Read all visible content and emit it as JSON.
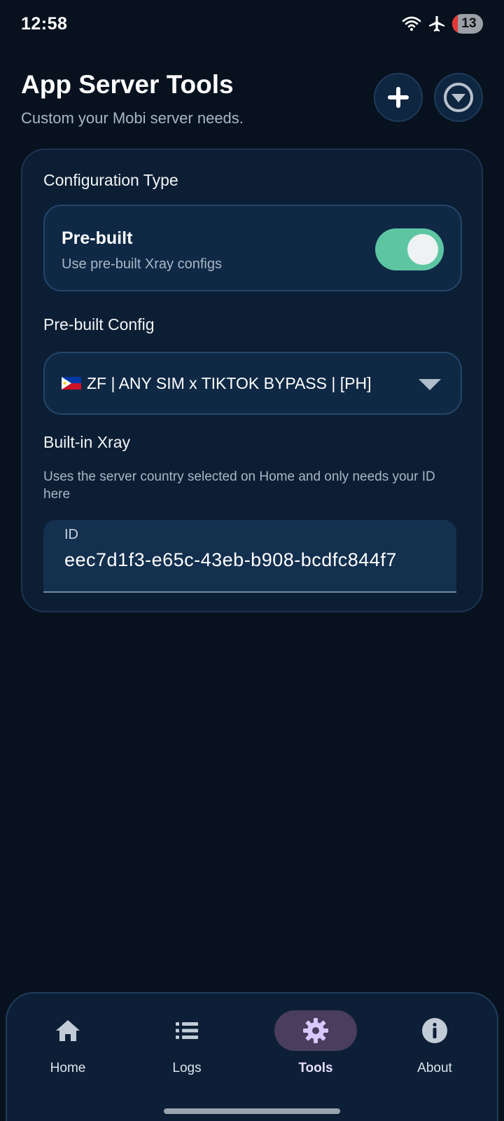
{
  "status_bar": {
    "time": "12:58",
    "battery_level": "13",
    "icons": [
      "wifi-icon",
      "airplane-icon",
      "battery-icon"
    ]
  },
  "header": {
    "title": "App Server Tools",
    "subtitle": "Custom your Mobi server needs.",
    "add_icon": "plus-icon",
    "collapse_icon": "chevron-down-circle-icon"
  },
  "config": {
    "section_label": "Configuration Type",
    "toggle": {
      "title": "Pre-built",
      "description": "Use pre-built Xray configs",
      "enabled": true
    },
    "prebuilt_label": "Pre-built Config",
    "selected_config": "ZF | ANY SIM x TIKTOK BYPASS | [PH]",
    "flag_icon": "philippines-flag-icon",
    "xray_label": "Built-in Xray",
    "xray_help": "Uses the server country selected on Home and only needs your ID here",
    "id_field": {
      "label": "ID",
      "value": "eec7d1f3-e65c-43eb-b908-bcdfc844f7"
    }
  },
  "colors": {
    "background": "#08121f",
    "card": "#0c1e33",
    "toggle_on": "#5ec5a3",
    "active_nav": "#4a3d5e"
  },
  "nav": {
    "items": [
      {
        "label": "Home",
        "icon": "home-icon",
        "active": false
      },
      {
        "label": "Logs",
        "icon": "list-icon",
        "active": false
      },
      {
        "label": "Tools",
        "icon": "gear-icon",
        "active": true
      },
      {
        "label": "About",
        "icon": "info-icon",
        "active": false
      }
    ]
  }
}
